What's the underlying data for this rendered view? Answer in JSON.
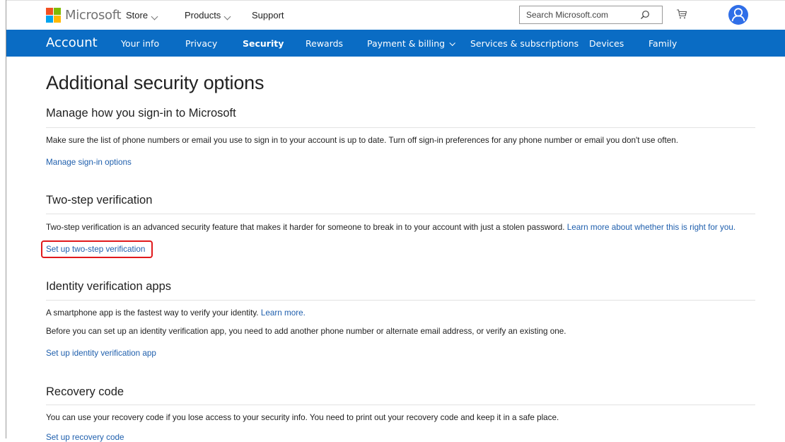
{
  "header": {
    "brand": "Microsoft",
    "logo_colors": [
      "#f25022",
      "#7fba00",
      "#00a4ef",
      "#ffb900"
    ],
    "nav": [
      {
        "label": "Store",
        "dropdown": true
      },
      {
        "label": "Products",
        "dropdown": true
      },
      {
        "label": "Support",
        "dropdown": false
      }
    ],
    "search_placeholder": "Search Microsoft.com",
    "icons": [
      "search-icon",
      "cart-icon",
      "avatar-icon"
    ]
  },
  "account_nav": {
    "title": "Account",
    "items": [
      {
        "label": "Your info"
      },
      {
        "label": "Privacy"
      },
      {
        "label": "Security",
        "active": true
      },
      {
        "label": "Rewards"
      },
      {
        "label": "Payment & billing",
        "dropdown": true
      },
      {
        "label": "Services & subscriptions"
      },
      {
        "label": "Devices"
      },
      {
        "label": "Family"
      }
    ],
    "bg_color": "#0a6cc4"
  },
  "page": {
    "title": "Additional security options",
    "sections": [
      {
        "heading": "Manage how you sign-in to Microsoft",
        "text": "Make sure the list of phone numbers or email you use to sign in to your account is up to date. Turn off sign-in preferences for any phone number or email you don't use often.",
        "link": "Manage sign-in options"
      },
      {
        "heading": "Two-step verification",
        "text": "Two-step verification is an advanced security feature that makes it harder for someone to break in to your account with just a stolen password. ",
        "inline_link": "Learn more about whether this is right for you.",
        "link": "Set up two-step verification",
        "highlight_color": "#e0191c"
      },
      {
        "heading": "Identity verification apps",
        "text": "A smartphone app is the fastest way to verify your identity. ",
        "inline_link": "Learn more.",
        "text2": "Before you can set up an identity verification app, you need to add another phone number or alternate email address, or verify an existing one.",
        "link": "Set up identity verification app"
      },
      {
        "heading": "Recovery code",
        "text": "You can use your recovery code if you lose access to your security info. You need to print out your recovery code and keep it in a safe place.",
        "link": "Set up recovery code"
      }
    ]
  }
}
